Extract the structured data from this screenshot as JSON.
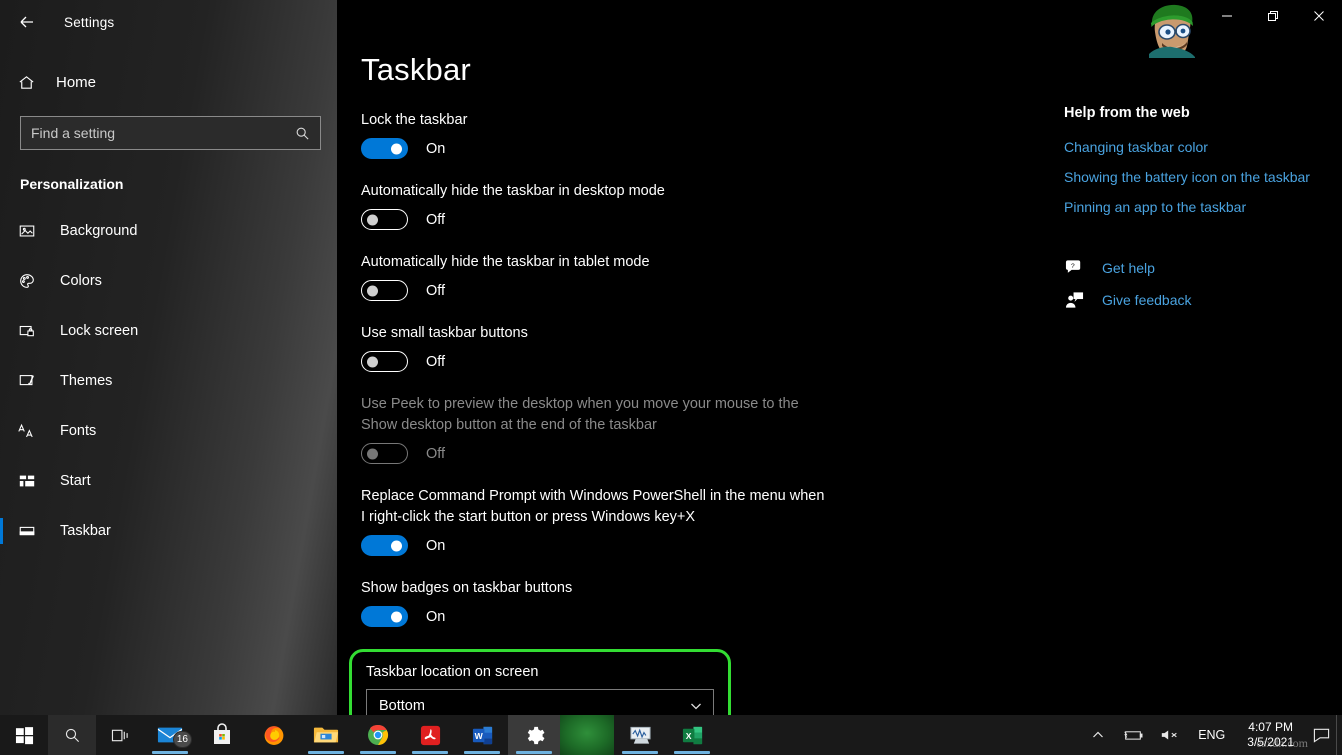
{
  "window": {
    "app_title": "Settings",
    "back_icon": "back-arrow-icon",
    "minimize_label": "─",
    "restore_label": "❐",
    "close_label": "✕"
  },
  "sidebar": {
    "home_label": "Home",
    "home_icon": "home-icon",
    "search": {
      "placeholder": "Find a setting",
      "value": "",
      "icon": "search-icon"
    },
    "category": "Personalization",
    "items": [
      {
        "label": "Background",
        "icon": "image-icon",
        "selected": false
      },
      {
        "label": "Colors",
        "icon": "palette-icon",
        "selected": false
      },
      {
        "label": "Lock screen",
        "icon": "lock-screen-icon",
        "selected": false
      },
      {
        "label": "Themes",
        "icon": "themes-brush-icon",
        "selected": false
      },
      {
        "label": "Fonts",
        "icon": "fonts-icon",
        "selected": false
      },
      {
        "label": "Start",
        "icon": "start-tiles-icon",
        "selected": false
      },
      {
        "label": "Taskbar",
        "icon": "taskbar-icon",
        "selected": true
      }
    ]
  },
  "main": {
    "page_title": "Taskbar",
    "settings": [
      {
        "label": "Lock the taskbar",
        "state": "On",
        "on": true,
        "disabled": false
      },
      {
        "label": "Automatically hide the taskbar in desktop mode",
        "state": "Off",
        "on": false,
        "disabled": false
      },
      {
        "label": "Automatically hide the taskbar in tablet mode",
        "state": "Off",
        "on": false,
        "disabled": false
      },
      {
        "label": "Use small taskbar buttons",
        "state": "Off",
        "on": false,
        "disabled": false
      },
      {
        "label": "Use Peek to preview the desktop when you move your mouse to the Show desktop button at the end of the taskbar",
        "state": "Off",
        "on": false,
        "disabled": true
      },
      {
        "label": "Replace Command Prompt with Windows PowerShell in the menu when I right-click the start button or press Windows key+X",
        "state": "On",
        "on": true,
        "disabled": false
      },
      {
        "label": "Show badges on taskbar buttons",
        "state": "On",
        "on": true,
        "disabled": false
      }
    ],
    "location_setting": {
      "label": "Taskbar location on screen",
      "value": "Bottom",
      "chevron_icon": "chevron-down-icon",
      "highlight_color": "#33dd33"
    }
  },
  "help": {
    "title": "Help from the web",
    "links": [
      "Changing taskbar color",
      "Showing the battery icon on the taskbar",
      "Pinning an app to the taskbar"
    ],
    "actions": [
      {
        "label": "Get help",
        "icon": "help-bubble-icon"
      },
      {
        "label": "Give feedback",
        "icon": "feedback-person-icon"
      }
    ],
    "link_color": "#4aa3e0"
  },
  "taskbar": {
    "start_icon": "windows-start-icon",
    "search_icon": "search-icon",
    "task_view_icon": "task-view-icon",
    "apps": [
      {
        "name": "mail-app",
        "badge": "16",
        "running": true
      },
      {
        "name": "microsoft-store-app",
        "badge": "",
        "running": false
      },
      {
        "name": "firefox-app",
        "badge": "",
        "running": true
      },
      {
        "name": "file-explorer-app",
        "badge": "",
        "running": true
      },
      {
        "name": "google-chrome-app",
        "badge": "",
        "running": true
      },
      {
        "name": "adobe-reader-app",
        "badge": "",
        "running": true
      },
      {
        "name": "microsoft-word-app",
        "badge": "",
        "running": true
      },
      {
        "name": "settings-app",
        "badge": "",
        "running": true,
        "active": true
      },
      {
        "name": "task-manager-app",
        "badge": "",
        "running": true
      },
      {
        "name": "microsoft-excel-app",
        "badge": "",
        "running": true
      }
    ],
    "tray": {
      "show_hidden_icon": "chevron-up-icon",
      "battery_icon": "battery-icon",
      "volume_icon": "volume-muted-icon",
      "language": "ENG",
      "time": "4:07 PM",
      "date": "3/5/2021",
      "action_center_icon": "action-center-icon"
    },
    "watermark": "esxdn.com"
  }
}
